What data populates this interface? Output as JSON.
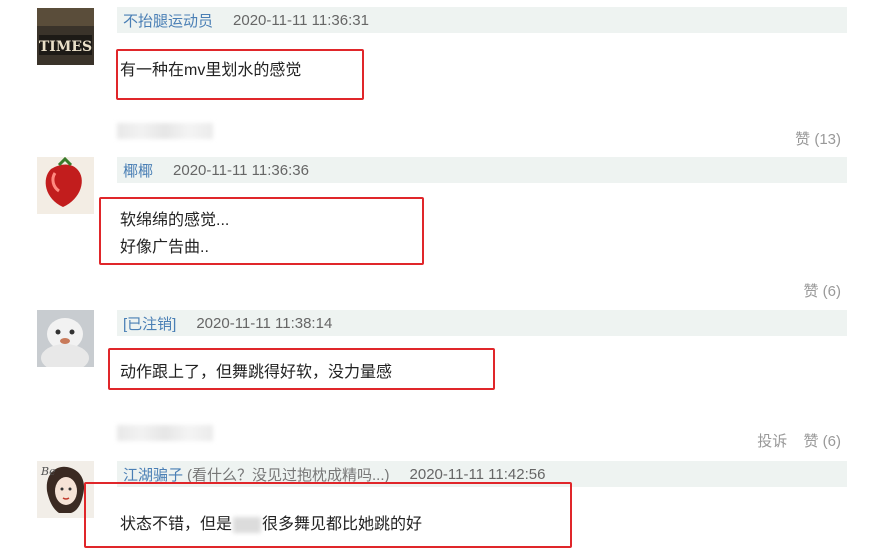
{
  "comments": [
    {
      "username": "不抬腿运动员",
      "timestamp": "2020-11-11 11:36:31",
      "lines": [
        "有一种在mv里划水的感觉"
      ],
      "like_label": "赞 (13)",
      "avatar_text": "TIMES"
    },
    {
      "username": "椰椰",
      "timestamp": "2020-11-11 11:36:36",
      "lines": [
        "软绵绵的感觉...",
        "好像广告曲.."
      ],
      "like_label": "赞 (6)"
    },
    {
      "username": "[已注销]",
      "timestamp": "2020-11-11 11:38:14",
      "lines": [
        "动作跟上了，但舞跳得好软，没力量感"
      ],
      "report_label": "投诉",
      "like_label": "赞 (6)"
    },
    {
      "username": "江湖骗子",
      "signature": "(看什么？没见过抱枕成精吗...)",
      "timestamp": "2020-11-11 11:42:56",
      "line_before": "状态不错，但是",
      "line_after": "很多舞见都比她跳的好"
    }
  ],
  "colors": {
    "highlight_border": "#e0262a",
    "username": "#4a7fb5",
    "header_bg": "#eef3f1"
  }
}
